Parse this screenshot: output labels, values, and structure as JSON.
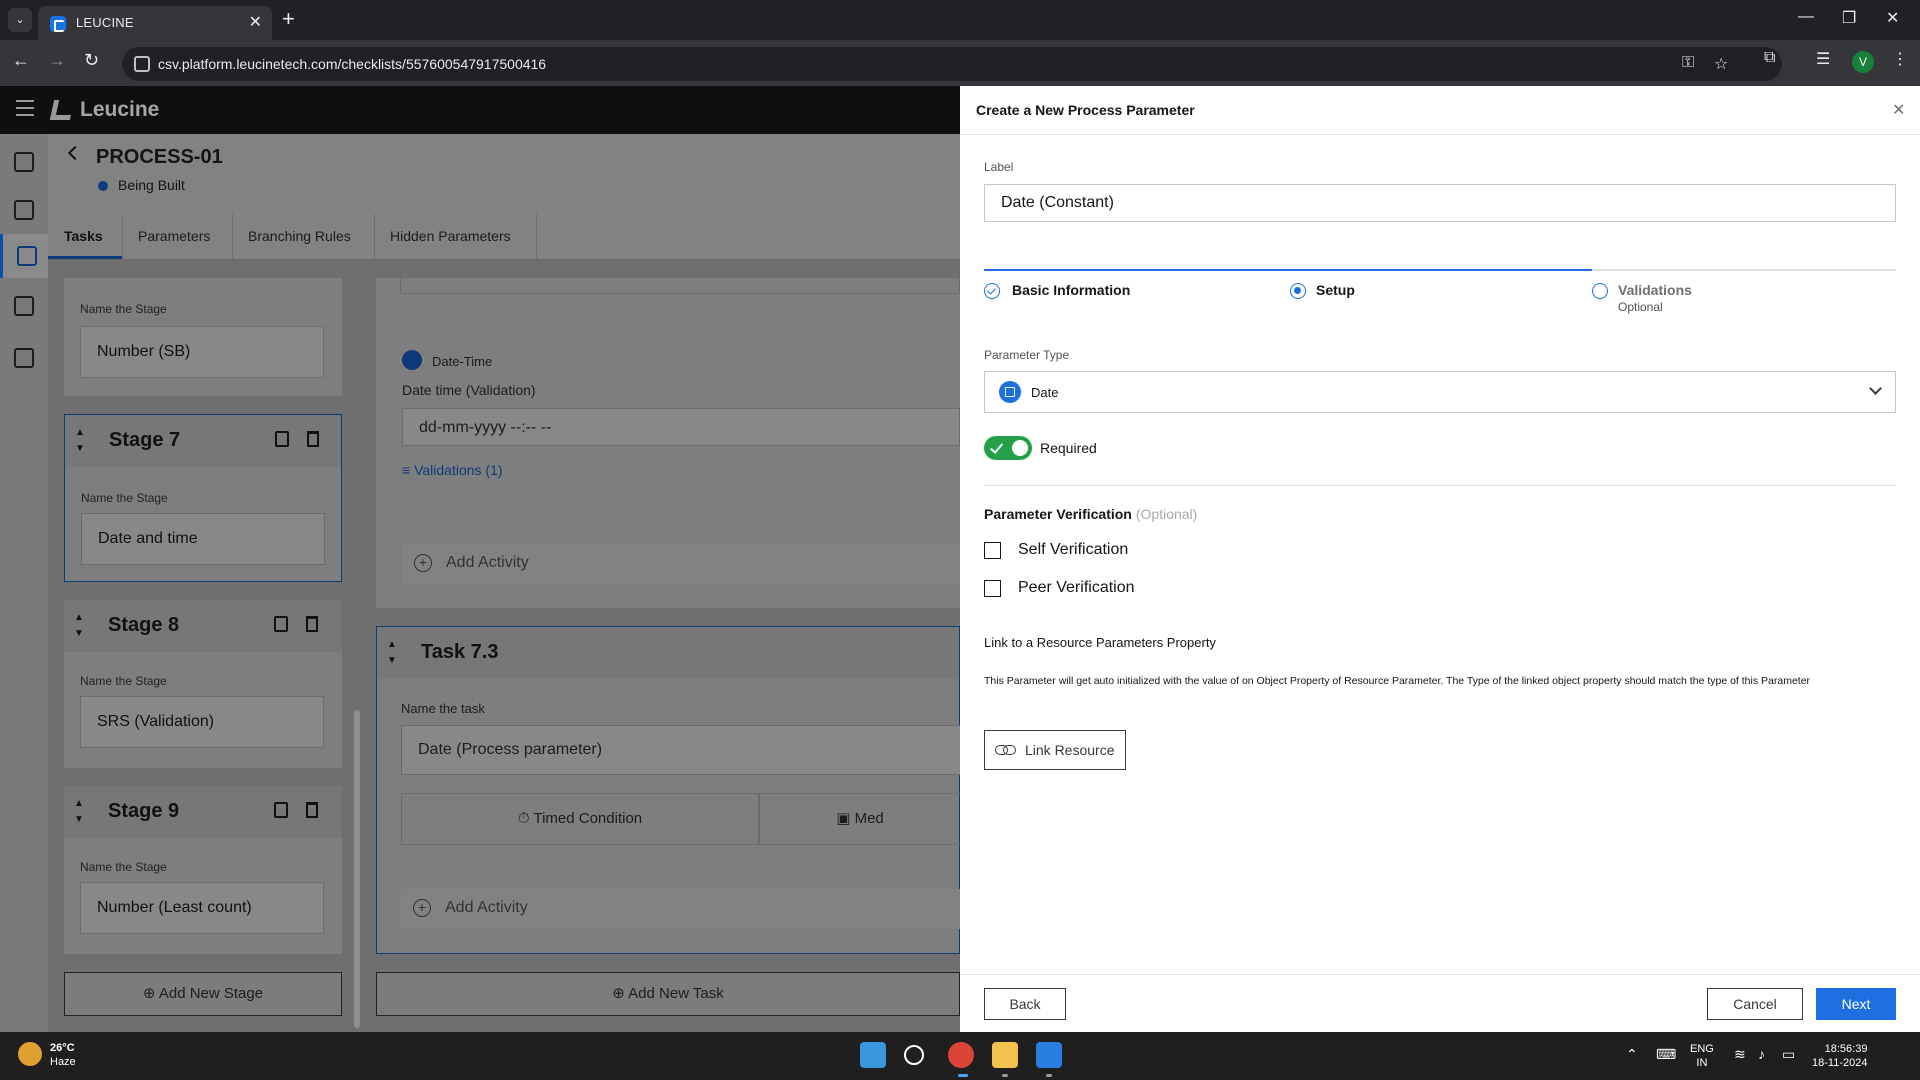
{
  "browser": {
    "tab_title": "LEUCINE",
    "url": "csv.platform.leucinetech.com/checklists/557600547917500416",
    "profile_initial": "V"
  },
  "app": {
    "logo_text": "Leucine",
    "process_title": "PROCESS-01",
    "status": "Being Built",
    "tabs": [
      "Tasks",
      "Parameters",
      "Branching Rules",
      "Hidden Parameters"
    ]
  },
  "stages": [
    {
      "name": "",
      "field_label": "Name the Stage",
      "value": "Number (SB)"
    },
    {
      "name": "Stage 7",
      "field_label": "Name the Stage",
      "value": "Date and time"
    },
    {
      "name": "Stage 8",
      "field_label": "Name the Stage",
      "value": "SRS (Validation)"
    },
    {
      "name": "Stage 9",
      "field_label": "Name the Stage",
      "value": "Number (Least count)"
    }
  ],
  "add_stage_label": "Add New Stage",
  "task_upper": {
    "param_type": "Date-Time",
    "param_label": "Date time (Validation)",
    "placeholder": "dd-mm-yyyy --:-- --",
    "validations_link": "Validations (1)",
    "add_activity": "Add Activity"
  },
  "task_lower": {
    "title": "Task 7.3",
    "field_label": "Name the task",
    "value": "Date (Process parameter)",
    "timed_condition": "Timed Condition",
    "media_partial": "Med",
    "add_activity": "Add Activity"
  },
  "add_task_label": "Add New Task",
  "drawer": {
    "title": "Create a New Process Parameter",
    "label_caption": "Label",
    "label_value": "Date (Constant)",
    "steps": [
      {
        "label": "Basic Information",
        "state": "done"
      },
      {
        "label": "Setup",
        "state": "current"
      },
      {
        "label": "Validations",
        "state": "pending",
        "sub": "Optional"
      }
    ],
    "param_type_caption": "Parameter Type",
    "param_type_value": "Date",
    "required_label": "Required",
    "required_on": true,
    "verification_title": "Parameter Verification",
    "verification_optional": "(Optional)",
    "self_verification": "Self Verification",
    "peer_verification": "Peer Verification",
    "link_title": "Link to a Resource Parameters Property",
    "link_desc": "This Parameter will get auto initialized with the value of on Object Property of Resource Parameter. The Type of the linked object property should match the type of this Parameter",
    "link_button": "Link Resource",
    "back": "Back",
    "cancel": "Cancel",
    "next": "Next"
  },
  "taskbar": {
    "temp": "26°C",
    "weather": "Haze",
    "lang1": "ENG",
    "lang2": "IN",
    "time": "18:56:39",
    "date": "18-11-2024"
  },
  "colors": {
    "accent": "#1d6fe0",
    "toggle_on": "#24a148"
  }
}
